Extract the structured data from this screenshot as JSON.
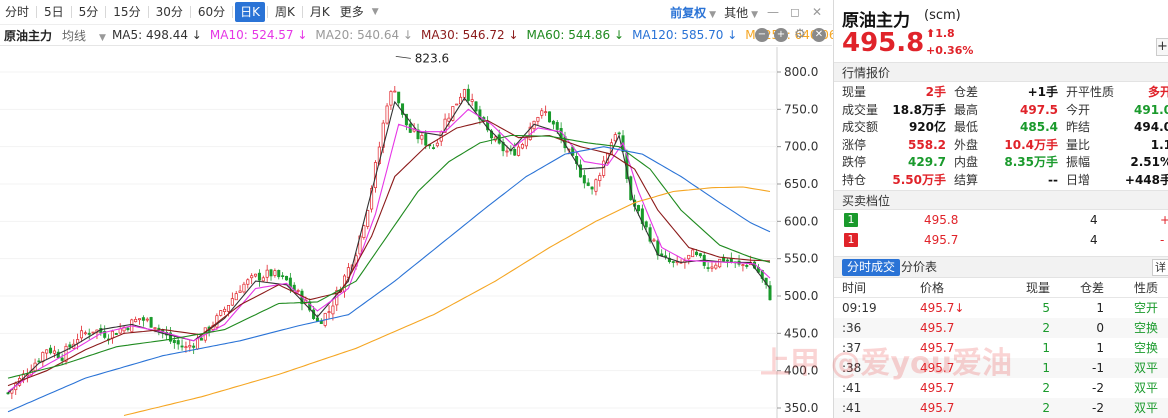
{
  "toolbar": {
    "periods": [
      "分时",
      "5日",
      "5分",
      "15分",
      "30分",
      "60分",
      "日K",
      "周K",
      "月K",
      "更多"
    ],
    "active_period": "日K",
    "adjust": "前复权",
    "other": "其他"
  },
  "ma_legend": {
    "name": "原油主力",
    "type": "均线",
    "items": [
      {
        "label": "MA5: 498.44 ↓",
        "color": "#333333"
      },
      {
        "label": "MA10: 524.57 ↓",
        "color": "#e636e6"
      },
      {
        "label": "MA20: 540.64 ↓",
        "color": "#9a9a9a"
      },
      {
        "label": "MA30: 546.72 ↓",
        "color": "#8b1a1a"
      },
      {
        "label": "MA60: 544.86 ↓",
        "color": "#1f8a1f"
      },
      {
        "label": "MA120: 585.70 ↓",
        "color": "#2a73d6"
      },
      {
        "label": "MA250: 640.06 ↓",
        "color": "#f5a623"
      }
    ]
  },
  "chart_data": {
    "type": "candlestick",
    "yaxis_ticks": [
      "800.0",
      "750.0",
      "700.0",
      "650.0",
      "600.0",
      "550.0",
      "500.0",
      "450.0",
      "400.0",
      "350.0"
    ],
    "ylim": [
      350,
      820
    ],
    "annotation_max": "823.6",
    "colors": {
      "up": "#e0232a",
      "down": "#1a9a2c"
    },
    "close_path": [
      [
        0,
        370
      ],
      [
        6,
        405
      ],
      [
        10,
        430
      ],
      [
        14,
        420
      ],
      [
        18,
        445
      ],
      [
        22,
        455
      ],
      [
        26,
        448
      ],
      [
        30,
        458
      ],
      [
        34,
        470
      ],
      [
        38,
        462
      ],
      [
        42,
        440
      ],
      [
        46,
        430
      ],
      [
        50,
        445
      ],
      [
        55,
        475
      ],
      [
        60,
        512
      ],
      [
        64,
        525
      ],
      [
        68,
        530
      ],
      [
        72,
        520
      ],
      [
        77,
        490
      ],
      [
        80,
        465
      ],
      [
        83,
        480
      ],
      [
        87,
        525
      ],
      [
        90,
        560
      ],
      [
        93,
        620
      ],
      [
        96,
        700
      ],
      [
        98,
        760
      ],
      [
        100,
        780
      ],
      [
        102,
        740
      ],
      [
        104,
        720
      ],
      [
        107,
        710
      ],
      [
        110,
        700
      ],
      [
        113,
        735
      ],
      [
        116,
        760
      ],
      [
        118,
        780
      ],
      [
        121,
        745
      ],
      [
        124,
        720
      ],
      [
        127,
        700
      ],
      [
        130,
        690
      ],
      [
        133,
        705
      ],
      [
        136,
        740
      ],
      [
        139,
        745
      ],
      [
        142,
        720
      ],
      [
        145,
        690
      ],
      [
        148,
        665
      ],
      [
        151,
        640
      ],
      [
        154,
        680
      ],
      [
        157,
        720
      ],
      [
        158,
        715
      ],
      [
        161,
        630
      ],
      [
        165,
        590
      ],
      [
        169,
        550
      ],
      [
        173,
        540
      ],
      [
        177,
        555
      ],
      [
        181,
        540
      ],
      [
        185,
        550
      ],
      [
        189,
        540
      ],
      [
        192,
        545
      ],
      [
        194,
        532
      ],
      [
        197,
        500
      ]
    ],
    "ma_series": [
      {
        "name": "MA5",
        "color": "#333333",
        "pts": [
          [
            0,
            370
          ],
          [
            8,
            410
          ],
          [
            16,
            430
          ],
          [
            24,
            455
          ],
          [
            32,
            462
          ],
          [
            40,
            450
          ],
          [
            48,
            440
          ],
          [
            56,
            470
          ],
          [
            64,
            520
          ],
          [
            72,
            515
          ],
          [
            80,
            472
          ],
          [
            88,
            520
          ],
          [
            94,
            640
          ],
          [
            100,
            760
          ],
          [
            106,
            720
          ],
          [
            112,
            715
          ],
          [
            118,
            765
          ],
          [
            124,
            725
          ],
          [
            130,
            695
          ],
          [
            136,
            730
          ],
          [
            142,
            720
          ],
          [
            148,
            670
          ],
          [
            154,
            672
          ],
          [
            158,
            715
          ],
          [
            162,
            620
          ],
          [
            168,
            555
          ],
          [
            174,
            545
          ],
          [
            180,
            548
          ],
          [
            186,
            545
          ],
          [
            192,
            545
          ],
          [
            197,
            510
          ]
        ]
      },
      {
        "name": "MA10",
        "color": "#e636e6",
        "pts": [
          [
            0,
            372
          ],
          [
            8,
            402
          ],
          [
            16,
            425
          ],
          [
            24,
            450
          ],
          [
            32,
            460
          ],
          [
            40,
            452
          ],
          [
            48,
            440
          ],
          [
            56,
            462
          ],
          [
            64,
            510
          ],
          [
            72,
            517
          ],
          [
            80,
            480
          ],
          [
            88,
            510
          ],
          [
            95,
            610
          ],
          [
            101,
            730
          ],
          [
            107,
            720
          ],
          [
            113,
            720
          ],
          [
            119,
            750
          ],
          [
            125,
            730
          ],
          [
            131,
            700
          ],
          [
            137,
            725
          ],
          [
            143,
            720
          ],
          [
            149,
            680
          ],
          [
            155,
            675
          ],
          [
            159,
            705
          ],
          [
            163,
            640
          ],
          [
            169,
            565
          ],
          [
            175,
            548
          ],
          [
            181,
            546
          ],
          [
            187,
            545
          ],
          [
            193,
            543
          ],
          [
            197,
            524
          ]
        ]
      },
      {
        "name": "MA30",
        "color": "#8b1a1a",
        "pts": [
          [
            0,
            380
          ],
          [
            10,
            400
          ],
          [
            20,
            428
          ],
          [
            30,
            450
          ],
          [
            40,
            455
          ],
          [
            50,
            448
          ],
          [
            60,
            488
          ],
          [
            70,
            515
          ],
          [
            78,
            495
          ],
          [
            86,
            505
          ],
          [
            94,
            580
          ],
          [
            100,
            660
          ],
          [
            108,
            700
          ],
          [
            116,
            725
          ],
          [
            124,
            735
          ],
          [
            132,
            712
          ],
          [
            140,
            715
          ],
          [
            148,
            700
          ],
          [
            156,
            690
          ],
          [
            162,
            670
          ],
          [
            168,
            615
          ],
          [
            176,
            565
          ],
          [
            184,
            552
          ],
          [
            192,
            548
          ],
          [
            197,
            547
          ]
        ]
      },
      {
        "name": "MA60",
        "color": "#1f8a1f",
        "pts": [
          [
            0,
            390
          ],
          [
            14,
            408
          ],
          [
            28,
            432
          ],
          [
            42,
            442
          ],
          [
            56,
            455
          ],
          [
            70,
            490
          ],
          [
            80,
            492
          ],
          [
            90,
            520
          ],
          [
            98,
            580
          ],
          [
            106,
            640
          ],
          [
            114,
            680
          ],
          [
            122,
            705
          ],
          [
            130,
            715
          ],
          [
            140,
            714
          ],
          [
            150,
            705
          ],
          [
            158,
            700
          ],
          [
            166,
            670
          ],
          [
            174,
            615
          ],
          [
            184,
            568
          ],
          [
            192,
            552
          ],
          [
            197,
            545
          ]
        ]
      },
      {
        "name": "MA120",
        "color": "#2a73d6",
        "pts": [
          [
            0,
            345
          ],
          [
            20,
            390
          ],
          [
            40,
            420
          ],
          [
            60,
            440
          ],
          [
            75,
            460
          ],
          [
            88,
            475
          ],
          [
            100,
            520
          ],
          [
            112,
            570
          ],
          [
            124,
            620
          ],
          [
            134,
            660
          ],
          [
            144,
            690
          ],
          [
            154,
            700
          ],
          [
            164,
            690
          ],
          [
            174,
            660
          ],
          [
            184,
            625
          ],
          [
            192,
            598
          ],
          [
            197,
            586
          ]
        ]
      },
      {
        "name": "MA250",
        "color": "#f5a623",
        "pts": [
          [
            30,
            340
          ],
          [
            50,
            365
          ],
          [
            70,
            395
          ],
          [
            90,
            430
          ],
          [
            110,
            475
          ],
          [
            126,
            520
          ],
          [
            140,
            565
          ],
          [
            152,
            600
          ],
          [
            162,
            625
          ],
          [
            172,
            640
          ],
          [
            182,
            645
          ],
          [
            190,
            646
          ],
          [
            197,
            640
          ]
        ]
      }
    ]
  },
  "panel": {
    "name": "原油主力",
    "code": "(scm)",
    "price": "495.8",
    "change": "1.8",
    "change_pct": "+0.36%",
    "plus_label": "+",
    "quote_title": "行情报价",
    "quote_rows": [
      [
        {
          "l": "现量",
          "v": "2手",
          "c": "red"
        },
        {
          "l": "仓差",
          "v": "+1手",
          "c": "black"
        },
        {
          "l": "开平性质",
          "v": "多开",
          "c": "red"
        }
      ],
      [
        {
          "l": "成交量",
          "v": "18.8万手",
          "c": "black"
        },
        {
          "l": "最高",
          "v": "497.5",
          "c": "red"
        },
        {
          "l": "今开",
          "v": "491.0",
          "c": "green"
        }
      ],
      [
        {
          "l": "成交额",
          "v": "920亿",
          "c": "black"
        },
        {
          "l": "最低",
          "v": "485.4",
          "c": "green"
        },
        {
          "l": "昨结",
          "v": "494.0",
          "c": "black"
        }
      ],
      [
        {
          "l": "涨停",
          "v": "558.2",
          "c": "red"
        },
        {
          "l": "外盘",
          "v": "10.4万手",
          "c": "red"
        },
        {
          "l": "量比",
          "v": "1.1",
          "c": "black"
        }
      ],
      [
        {
          "l": "跌停",
          "v": "429.7",
          "c": "green"
        },
        {
          "l": "内盘",
          "v": "8.35万手",
          "c": "green"
        },
        {
          "l": "振幅",
          "v": "2.51%",
          "c": "black"
        }
      ],
      [
        {
          "l": "持仓",
          "v": "5.50万手",
          "c": "red"
        },
        {
          "l": "结算",
          "v": "--",
          "c": "black"
        },
        {
          "l": "日增",
          "v": "+448手",
          "c": "black"
        }
      ]
    ],
    "orderbook_title": "买卖档位",
    "orderbook": [
      {
        "level": "1",
        "price": "495.8",
        "vol": "4",
        "x": "+",
        "badge": "#1a9a2c"
      },
      {
        "level": "1",
        "price": "495.7",
        "vol": "4",
        "x": "-",
        "badge": "#e0232a"
      }
    ],
    "tab_active": "分时成交",
    "tab_other": "分价表",
    "detail_btn": "详",
    "trade_cols": [
      "时间",
      "价格",
      "现量",
      "仓差",
      "性质"
    ],
    "trades": [
      {
        "time": "09:19",
        "price": "495.7↓",
        "vol": "5",
        "oi": "1",
        "nat": "空开"
      },
      {
        "time": ":36",
        "price": "495.7",
        "vol": "2",
        "oi": "0",
        "nat": "空换"
      },
      {
        "time": ":37",
        "price": "495.7",
        "vol": "1",
        "oi": "1",
        "nat": "空换"
      },
      {
        "time": ":38",
        "price": "495.7",
        "vol": "1",
        "oi": "-1",
        "nat": "双平"
      },
      {
        "time": ":41",
        "price": "495.7",
        "vol": "2",
        "oi": "-2",
        "nat": "双平"
      },
      {
        "time": ":41",
        "price": "495.7",
        "vol": "2",
        "oi": "-2",
        "nat": "双平"
      }
    ]
  },
  "watermark": "上甲 @爱you爱油"
}
